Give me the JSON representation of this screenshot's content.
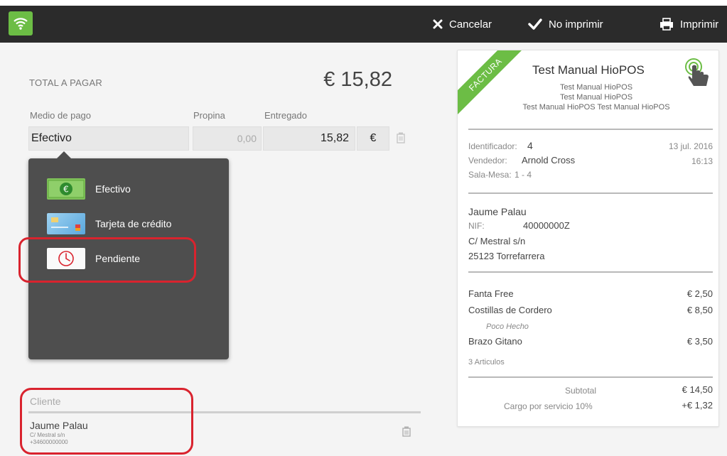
{
  "toolbar": {
    "cancel_label": "Cancelar",
    "no_print_label": "No imprimir",
    "print_label": "Imprimir"
  },
  "payment": {
    "total_label": "TOTAL A PAGAR",
    "total_value": "€ 15,82",
    "col_medio": "Medio de pago",
    "col_propina": "Propina",
    "col_entregado": "Entregado",
    "medio_value": "Efectivo",
    "propina_value": "0,00",
    "entregado_value": "15,82",
    "currency": "€"
  },
  "payment_methods": [
    {
      "label": "Efectivo",
      "icon": "cash-icon"
    },
    {
      "label": "Tarjeta de crédito",
      "icon": "credit-card-icon"
    },
    {
      "label": "Pendiente",
      "icon": "clock-icon"
    }
  ],
  "client": {
    "label": "Cliente",
    "name": "Jaume Palau",
    "address": "C/ Mestral s/n",
    "phone": "+34600000000"
  },
  "receipt": {
    "ribbon": "FACTURA",
    "title": "Test Manual HioPOS",
    "sub1": "Test Manual HioPOS",
    "sub2": "Test Manual HioPOS",
    "sub3": "Test Manual HioPOS Test Manual HioPOS",
    "id_label": "Identificador:",
    "id_value": "4",
    "date": "13 jul. 2016",
    "seller_label": "Vendedor:",
    "seller_value": "Arnold Cross",
    "time": "16:13",
    "table_label": "Sala-Mesa:",
    "table_value": "1 - 4",
    "customer_name": "Jaume Palau",
    "nif_label": "NIF:",
    "nif_value": "40000000Z",
    "address": "C/ Mestral s/n",
    "city": "25123 Torrefarrera",
    "items": [
      {
        "name": "Fanta Free",
        "price": "€ 2,50"
      },
      {
        "name": "Costillas de Cordero",
        "price": "€ 8,50",
        "note": "Poco Hecho"
      },
      {
        "name": "Brazo Gitano",
        "price": "€ 3,50"
      }
    ],
    "items_count": "3 Articulos",
    "subtotal_label": "Subtotal",
    "subtotal_value": "€ 14,50",
    "service_label": "Cargo por servicio 10%",
    "service_value": "+€ 1,32"
  },
  "colors": {
    "brand_green": "#6cbd45",
    "topbar": "#2b2b2b",
    "highlight_red": "#d9232e",
    "dropdown_bg": "#4e4e4e"
  }
}
